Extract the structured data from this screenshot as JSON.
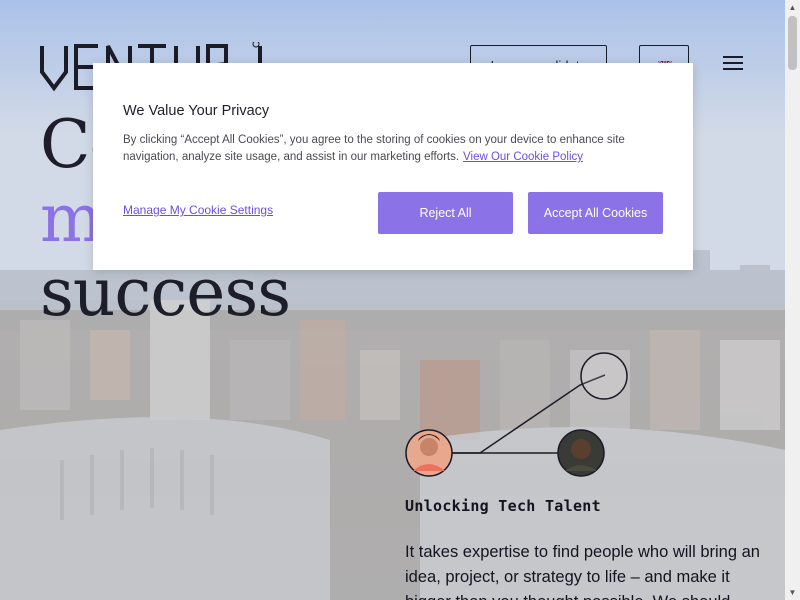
{
  "header": {
    "logo_text": "VENTURI",
    "candidate_button": "I am a candidate",
    "language_icon": "uk-flag-icon",
    "menu_icon": "hamburger-menu-icon"
  },
  "hero": {
    "headline_line1": "Co",
    "headline_line2": "m",
    "headline_line3": "success",
    "accent_color": "#8b72e6",
    "tagline": "Unlocking Tech Talent",
    "body": "It takes expertise to find people who will bring an idea, project, or strategy to life – and make it bigger than you thought possible. We should"
  },
  "cookie_banner": {
    "title": "We Value Your Privacy",
    "text": "By clicking “Accept All Cookies”, you agree to the storing of cookies on your device to enhance site navigation, analyze site usage, and assist in our marketing efforts.",
    "policy_link": "View Our Cookie Policy",
    "manage_link": "Manage My Cookie Settings",
    "reject_button": "Reject All",
    "accept_button": "Accept All Cookies",
    "button_color": "#8b72e6"
  }
}
